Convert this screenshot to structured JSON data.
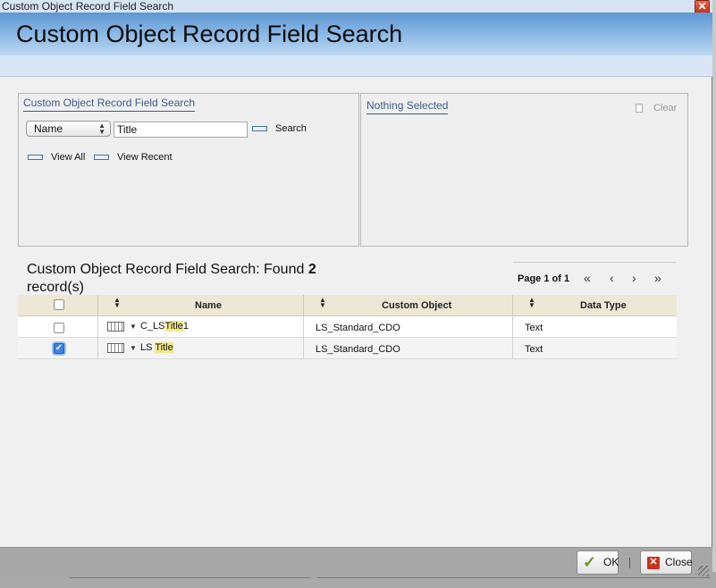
{
  "window": {
    "title": "Custom Object Record Field Search",
    "close_glyph": "✕"
  },
  "header": {
    "title": "Custom Object Record Field Search"
  },
  "search_panel": {
    "heading": "Custom Object Record Field Search",
    "field_select": "Name",
    "query": "Title",
    "search_label": "Search",
    "view_all_label": "View All",
    "view_recent_label": "View Recent"
  },
  "selection_panel": {
    "heading": "Nothing Selected",
    "clear_label": "Clear"
  },
  "results": {
    "title_prefix": "Custom Object Record Field Search: Found",
    "count": "2",
    "title_suffix": "record(s)"
  },
  "pager": {
    "text": "Page 1 of 1",
    "first": "«",
    "prev": "‹",
    "next": "›",
    "last": "»"
  },
  "grid": {
    "columns": [
      "Name",
      "Custom Object",
      "Data Type"
    ],
    "rows": [
      {
        "checked": false,
        "name_before": "C_LS",
        "name_match": "Title",
        "name_after": "1",
        "custom_object": "LS_Standard_CDO",
        "data_type": "Text"
      },
      {
        "checked": true,
        "name_before": "LS ",
        "name_match": "Title",
        "name_after": "",
        "custom_object": "LS_Standard_CDO",
        "data_type": "Text"
      }
    ]
  },
  "footer": {
    "ok_label": "OK",
    "close_label": "Close"
  },
  "colors": {
    "header_blue": "#5e97d3",
    "highlight": "#f3e98d",
    "link_blue": "#3d5c86",
    "close_red": "#c9351e"
  }
}
